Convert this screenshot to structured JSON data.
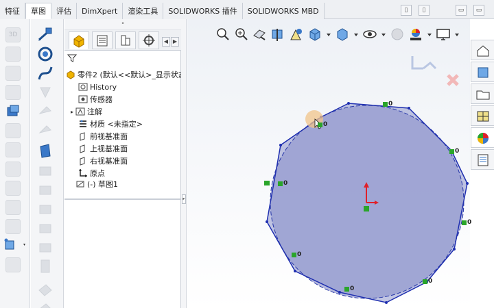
{
  "tabs": [
    {
      "label": "特征",
      "active": false
    },
    {
      "label": "草图",
      "active": true
    },
    {
      "label": "评估",
      "active": false
    },
    {
      "label": "DimXpert",
      "active": false
    },
    {
      "label": "渲染工具",
      "active": false
    },
    {
      "label": "SOLIDWORKS 插件",
      "active": false
    },
    {
      "label": "SOLIDWORKS MBD",
      "active": false
    }
  ],
  "left_toolbar": {
    "label_3d": "3D"
  },
  "feature_tree": {
    "root": "零件2 (默认<<默认>_显示状态",
    "items": [
      {
        "label": "History",
        "icon": "history-icon"
      },
      {
        "label": "传感器",
        "icon": "sensor-icon"
      },
      {
        "label": "注解",
        "icon": "annotation-icon",
        "expandable": true
      },
      {
        "label": "材质 <未指定>",
        "icon": "material-icon"
      },
      {
        "label": "前视基准面",
        "icon": "plane-icon"
      },
      {
        "label": "上视基准面",
        "icon": "plane-icon"
      },
      {
        "label": "右视基准面",
        "icon": "plane-icon"
      },
      {
        "label": "原点",
        "icon": "origin-icon"
      }
    ],
    "sketch": "(-) 草图1"
  },
  "sketch": {
    "relation_label": "0",
    "fill_color": "#9fa6d4",
    "line_color": "#1f2fb0"
  },
  "colors": {
    "accent": "#3a78c8",
    "origin_red": "#e0202a",
    "relation_green": "#2aa52a"
  }
}
